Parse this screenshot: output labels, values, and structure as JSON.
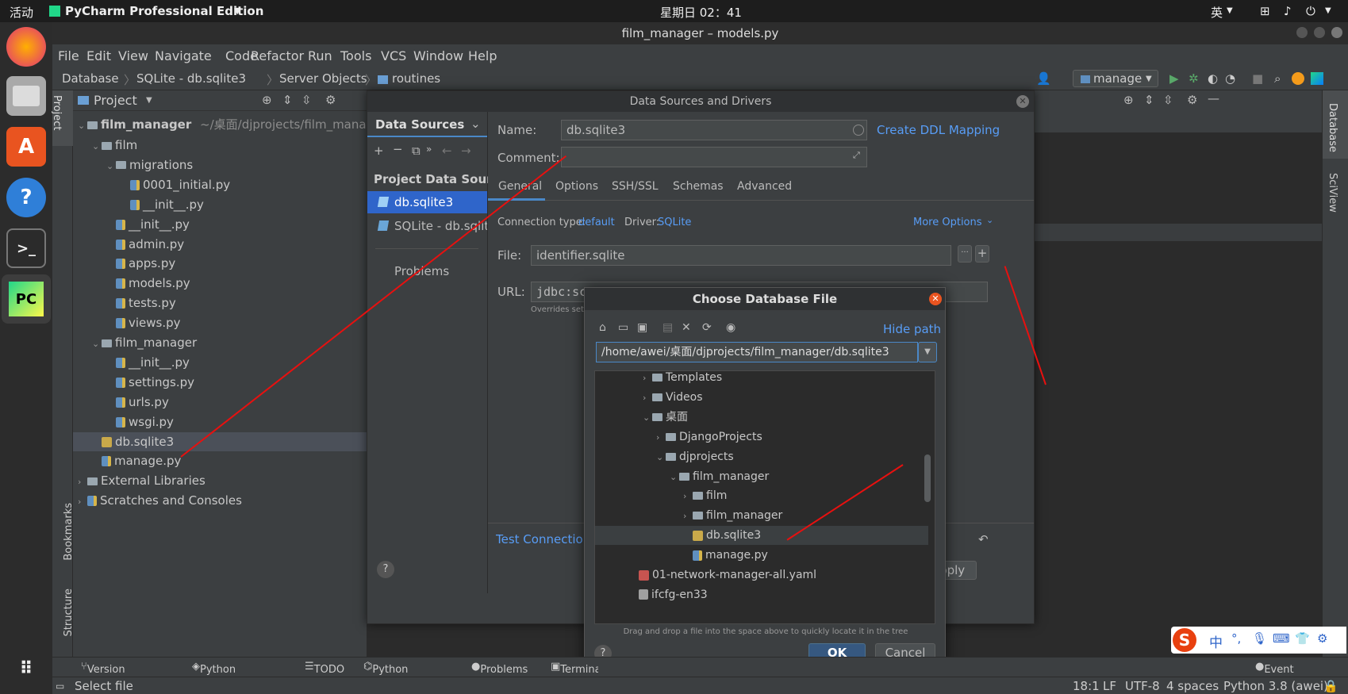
{
  "topbar": {
    "activities": "活动",
    "app_name": "PyCharm Professional Edition",
    "clock": "星期日 02：41",
    "ime": "英"
  },
  "window": {
    "title": "film_manager – models.py"
  },
  "menu": [
    "File",
    "Edit",
    "View",
    "Navigate",
    "Code",
    "Refactor",
    "Run",
    "Tools",
    "VCS",
    "Window",
    "Help"
  ],
  "breadcrumb": [
    "Database",
    "SQLite - db.sqlite3",
    "Server Objects",
    "routines"
  ],
  "run_config": "manage",
  "project": {
    "header": "Project",
    "root_name": "film_manager",
    "root_path": "~/桌面/djprojects/film_manage",
    "items": [
      {
        "label": "film",
        "depth": 1,
        "kind": "folder",
        "open": true
      },
      {
        "label": "migrations",
        "depth": 2,
        "kind": "folder",
        "open": true
      },
      {
        "label": "0001_initial.py",
        "depth": 3,
        "kind": "py"
      },
      {
        "label": "__init__.py",
        "depth": 3,
        "kind": "py"
      },
      {
        "label": "__init__.py",
        "depth": 2,
        "kind": "py"
      },
      {
        "label": "admin.py",
        "depth": 2,
        "kind": "py"
      },
      {
        "label": "apps.py",
        "depth": 2,
        "kind": "py"
      },
      {
        "label": "models.py",
        "depth": 2,
        "kind": "py"
      },
      {
        "label": "tests.py",
        "depth": 2,
        "kind": "py"
      },
      {
        "label": "views.py",
        "depth": 2,
        "kind": "py"
      },
      {
        "label": "film_manager",
        "depth": 1,
        "kind": "folder",
        "open": true
      },
      {
        "label": "__init__.py",
        "depth": 2,
        "kind": "py"
      },
      {
        "label": "settings.py",
        "depth": 2,
        "kind": "py"
      },
      {
        "label": "urls.py",
        "depth": 2,
        "kind": "py"
      },
      {
        "label": "wsgi.py",
        "depth": 2,
        "kind": "py"
      },
      {
        "label": "db.sqlite3",
        "depth": 1,
        "kind": "db",
        "selected": true
      },
      {
        "label": "manage.py",
        "depth": 1,
        "kind": "py"
      },
      {
        "label": "External Libraries",
        "depth": 0,
        "kind": "lib"
      },
      {
        "label": "Scratches and Consoles",
        "depth": 0,
        "kind": "scratch"
      }
    ]
  },
  "left_strip": {
    "project": "Project",
    "bookmarks": "Bookmarks",
    "structure": "Structure"
  },
  "right_strip": {
    "database": "Database",
    "sciview": "SciView"
  },
  "ds_dialog": {
    "title": "Data Sources and Drivers",
    "tab_data_sources": "Data Sources",
    "section": "Project Data Sour...",
    "sources": [
      "db.sqlite3",
      "SQLite - db.sqlite"
    ],
    "problems": "Problems",
    "name_label": "Name:",
    "name_value": "db.sqlite3",
    "comment_label": "Comment:",
    "create_ddl": "Create DDL Mapping",
    "tabs": [
      "General",
      "Options",
      "SSH/SSL",
      "Schemas",
      "Advanced"
    ],
    "conn_type_label": "Connection type:",
    "conn_type_value": "default",
    "driver_label": "Driver:",
    "driver_value": "SQLite",
    "more_options": "More Options",
    "file_label": "File:",
    "file_value": "identifier.sqlite",
    "url_label": "URL:",
    "url_value": "jdbc:sc",
    "overrides": "Overrides set",
    "test_connection": "Test Connection",
    "apply": "Apply"
  },
  "cf_dialog": {
    "title": "Choose Database File",
    "hide_path": "Hide path",
    "path": "/home/awei/桌面/djprojects/film_manager/db.sqlite3",
    "tree": [
      {
        "label": "Templates",
        "depth": 0,
        "kind": "folder",
        "arrow": "right"
      },
      {
        "label": "Videos",
        "depth": 0,
        "kind": "folder",
        "arrow": "right"
      },
      {
        "label": "桌面",
        "depth": 0,
        "kind": "folder",
        "arrow": "down"
      },
      {
        "label": "DjangoProjects",
        "depth": 1,
        "kind": "folder",
        "arrow": "right"
      },
      {
        "label": "djprojects",
        "depth": 1,
        "kind": "folder",
        "arrow": "down"
      },
      {
        "label": "film_manager",
        "depth": 2,
        "kind": "folder",
        "arrow": "down"
      },
      {
        "label": "film",
        "depth": 3,
        "kind": "folder",
        "arrow": "right"
      },
      {
        "label": "film_manager",
        "depth": 3,
        "kind": "folder",
        "arrow": "right"
      },
      {
        "label": "db.sqlite3",
        "depth": 3,
        "kind": "db",
        "selected": true
      },
      {
        "label": "manage.py",
        "depth": 3,
        "kind": "py"
      },
      {
        "label": "01-network-manager-all.yaml",
        "depth": -1,
        "kind": "yaml"
      },
      {
        "label": "ifcfg-en33",
        "depth": -1,
        "kind": "file"
      }
    ],
    "hint": "Drag and drop a file into the space above to quickly locate it in the tree",
    "ok": "OK",
    "cancel": "Cancel"
  },
  "bottom_tabs": [
    "Version Control",
    "Python Packages",
    "TODO",
    "Python Console",
    "Problems",
    "Terminal"
  ],
  "event_log": "Event Log",
  "status": {
    "message": "Select file",
    "position": "18:1",
    "line_sep": "LF",
    "encoding": "UTF-8",
    "indent": "4 spaces",
    "interpreter": "Python 3.8 (awei)"
  },
  "ime_tray": [
    "中",
    "°,",
    "🎤",
    "⌨",
    "👕",
    "⚙"
  ],
  "colors": {
    "accent": "#589df6",
    "selection": "#2f65ca",
    "annotation": "#e8100f"
  }
}
